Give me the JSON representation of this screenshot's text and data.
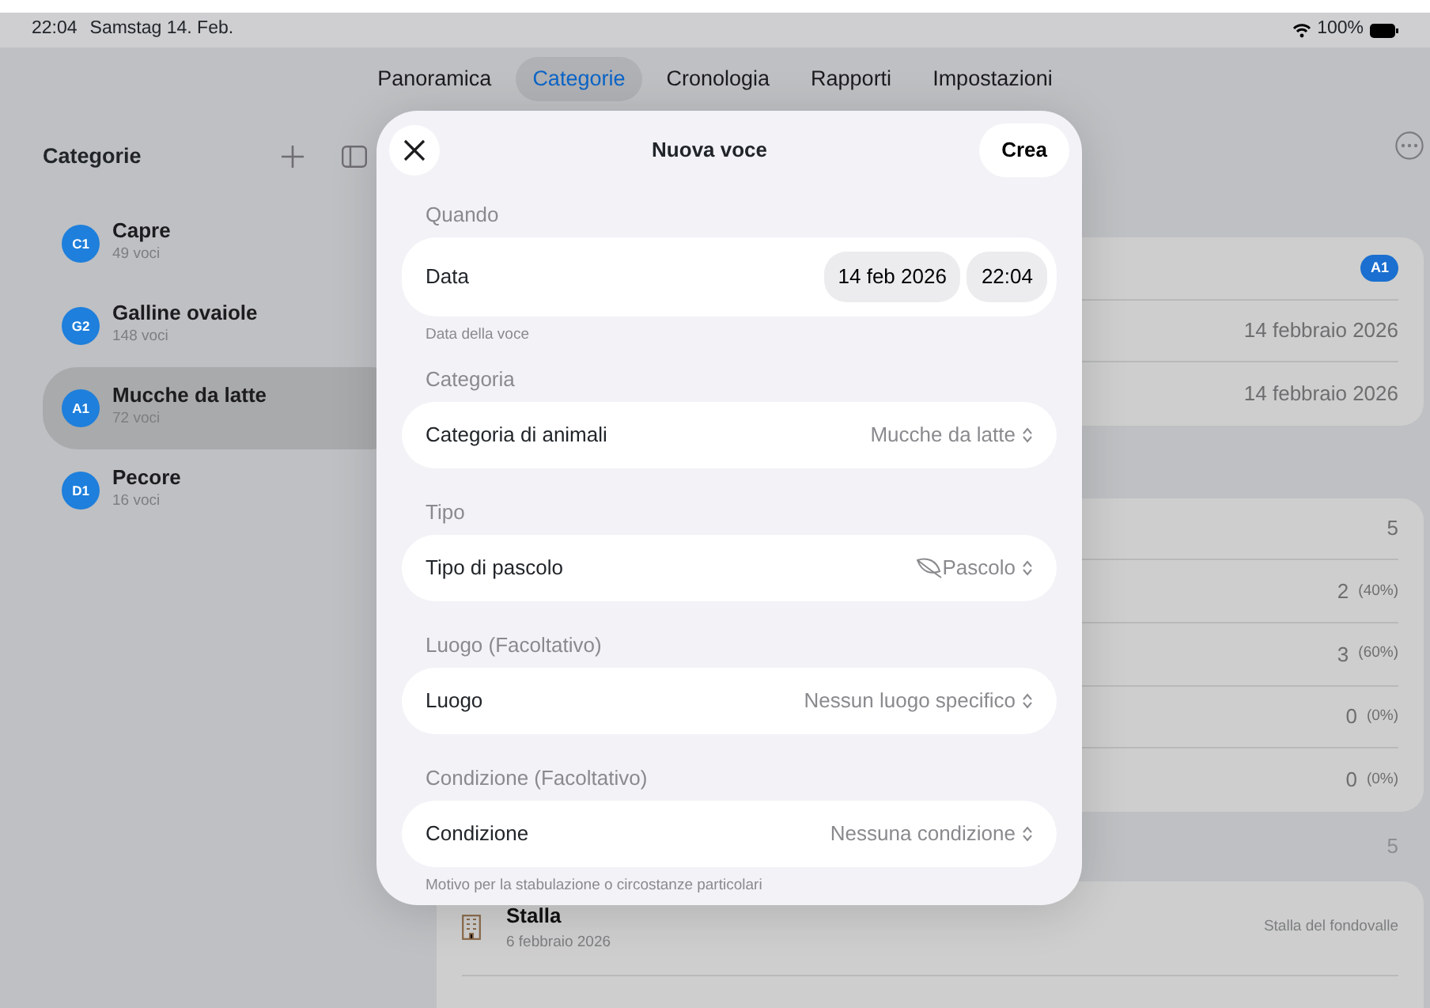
{
  "status_bar": {
    "time": "22:04",
    "date": "Samstag 14. Feb.",
    "battery": "100%"
  },
  "tabs": [
    {
      "label": "Panoramica",
      "selected": false
    },
    {
      "label": "Categorie",
      "selected": true
    },
    {
      "label": "Cronologia",
      "selected": false
    },
    {
      "label": "Rapporti",
      "selected": false
    },
    {
      "label": "Impostazioni",
      "selected": false
    }
  ],
  "sidebar": {
    "title": "Categorie",
    "items": [
      {
        "code": "C1",
        "name": "Capre",
        "count": "49 voci",
        "selected": false
      },
      {
        "code": "G2",
        "name": "Galline ovaiole",
        "count": "148 voci",
        "selected": false
      },
      {
        "code": "A1",
        "name": "Mucche da latte",
        "count": "72 voci",
        "selected": true
      },
      {
        "code": "D1",
        "name": "Pecore",
        "count": "16 voci",
        "selected": false
      }
    ]
  },
  "detail": {
    "badge": "A1",
    "dates": [
      "14 febbraio 2026",
      "14 febbraio 2026"
    ],
    "stats": [
      {
        "value": "5"
      },
      {
        "value": "2",
        "share": "(40%)"
      },
      {
        "value": "3",
        "share": "(60%)"
      },
      {
        "value": "0",
        "share": "(0%)"
      },
      {
        "value": "0",
        "share": "(0%)"
      }
    ],
    "section_count": "5",
    "locations": [
      {
        "name": "Stalla",
        "date": "6 febbraio 2026",
        "place": "Stalla del fondovalle"
      }
    ]
  },
  "modal": {
    "title": "Nuova voce",
    "action": "Crea",
    "sections": [
      {
        "label": "Quando",
        "kind": "datetime",
        "field": "Data",
        "date": "14 feb 2026",
        "time": "22:04",
        "footer": "Data della voce"
      },
      {
        "label": "Categoria",
        "kind": "picker",
        "field": "Categoria di animali",
        "value": "Mucche da latte"
      },
      {
        "label": "Tipo",
        "kind": "iconpicker",
        "field": "Tipo di pascolo",
        "value": "Pascolo"
      },
      {
        "label": "Luogo (Facoltativo)",
        "kind": "picker",
        "field": "Luogo",
        "value": "Nessun luogo specifico"
      },
      {
        "label": "Condizione (Facoltativo)",
        "kind": "picker",
        "field": "Condizione",
        "value": "Nessuna condizione",
        "footer": "Motivo per la stabulazione o circostanze particolari"
      }
    ]
  }
}
